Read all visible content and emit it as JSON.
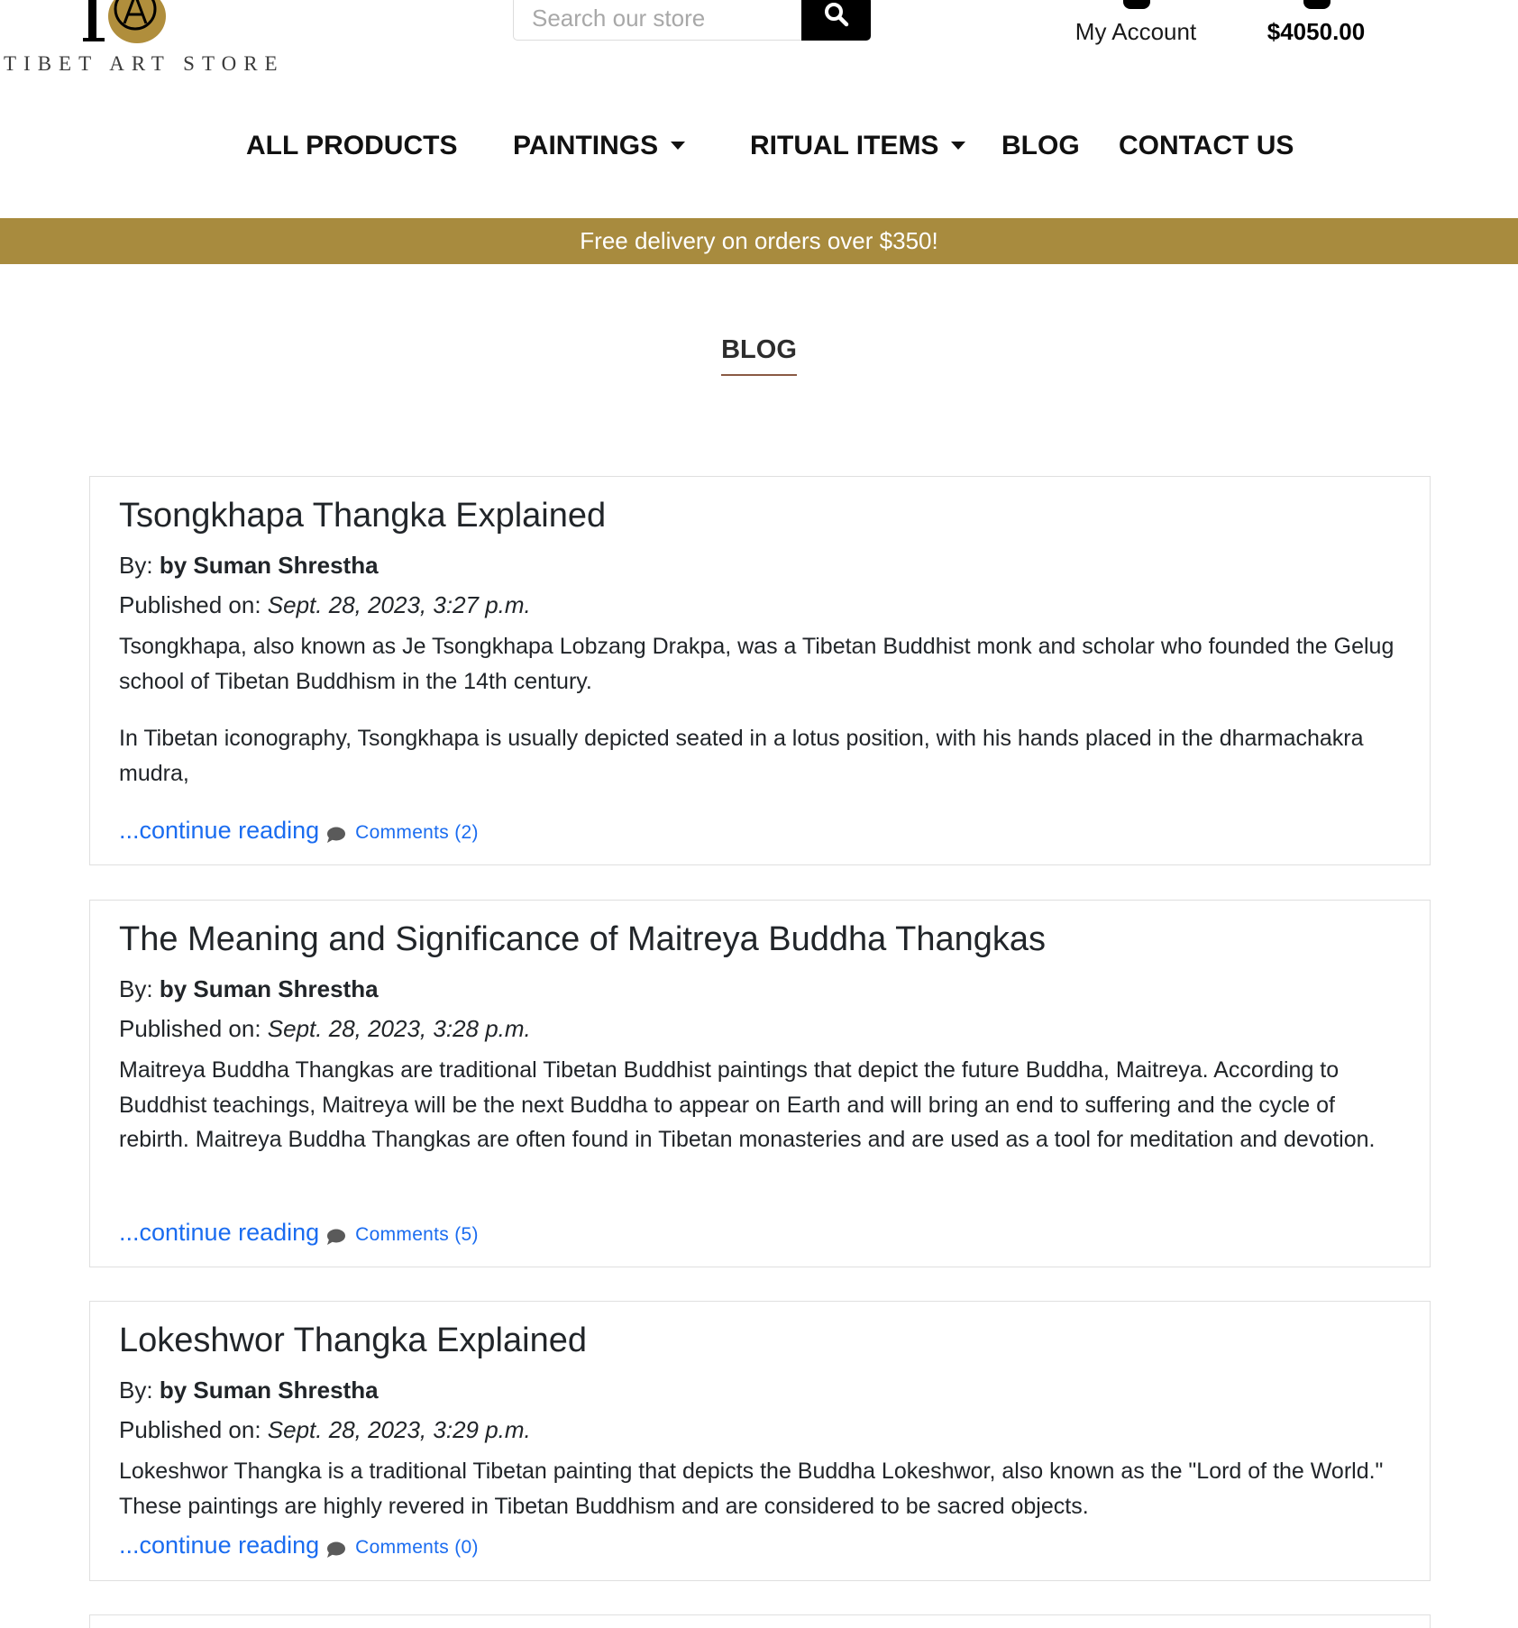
{
  "brand": {
    "name": "TIBET ART STORE",
    "monogram": "TAS"
  },
  "search": {
    "placeholder": "Search our store"
  },
  "account": {
    "label": "My Account"
  },
  "cart": {
    "total": "$4050.00"
  },
  "nav": {
    "items": [
      {
        "label": "ALL PRODUCTS",
        "dropdown": false
      },
      {
        "label": "PAINTINGS",
        "dropdown": true
      },
      {
        "label": "RITUAL ITEMS",
        "dropdown": true
      },
      {
        "label": "BLOG",
        "dropdown": false
      },
      {
        "label": "CONTACT US",
        "dropdown": false
      }
    ]
  },
  "banner": {
    "text": "Free delivery on orders over $350!"
  },
  "page": {
    "title": "BLOG"
  },
  "labels": {
    "by": "By:",
    "published": "Published on:",
    "continue": "...continue reading"
  },
  "posts": [
    {
      "title": "Tsongkhapa Thangka Explained",
      "author": "by Suman Shrestha",
      "published": "Sept. 28, 2023, 3:27 p.m.",
      "paragraphs": [
        "Tsongkhapa, also known as Je Tsongkhapa Lobzang Drakpa, was a Tibetan Buddhist monk and scholar who founded the Gelug school of Tibetan Buddhism in the 14th century.",
        "In Tibetan iconography, Tsongkhapa is usually depicted seated in a lotus position, with his hands placed in the dharmachakra mudra,"
      ],
      "comments": "Comments (2)"
    },
    {
      "title": "The Meaning and Significance of Maitreya Buddha Thangkas",
      "author": "by Suman Shrestha",
      "published": "Sept. 28, 2023, 3:28 p.m.",
      "paragraphs": [
        "Maitreya Buddha Thangkas are traditional Tibetan Buddhist paintings that depict the future Buddha, Maitreya. According to Buddhist teachings, Maitreya will be the next Buddha to appear on Earth and will bring an end to suffering and the cycle of rebirth. Maitreya Buddha Thangkas are often found in Tibetan monasteries and are used as a tool for meditation and devotion."
      ],
      "comments": "Comments (5)"
    },
    {
      "title": "Lokeshwor Thangka Explained",
      "author": "by Suman Shrestha",
      "published": "Sept. 28, 2023, 3:29 p.m.",
      "paragraphs": [
        "Lokeshwor Thangka is a traditional Tibetan painting that depicts the Buddha Lokeshwor, also known as the \"Lord of the World.\" These paintings are highly revered in Tibetan Buddhism and are considered to be sacred objects."
      ],
      "comments": "Comments (0)"
    }
  ],
  "colors": {
    "banner": "#a88b3e",
    "link": "#1a6cf0",
    "title_underline": "#8a5a44",
    "logo_gold": "#b08e3c"
  },
  "icons": [
    "search-icon",
    "user-icon",
    "cart-icon",
    "comment-icon",
    "caret-down-icon"
  ]
}
